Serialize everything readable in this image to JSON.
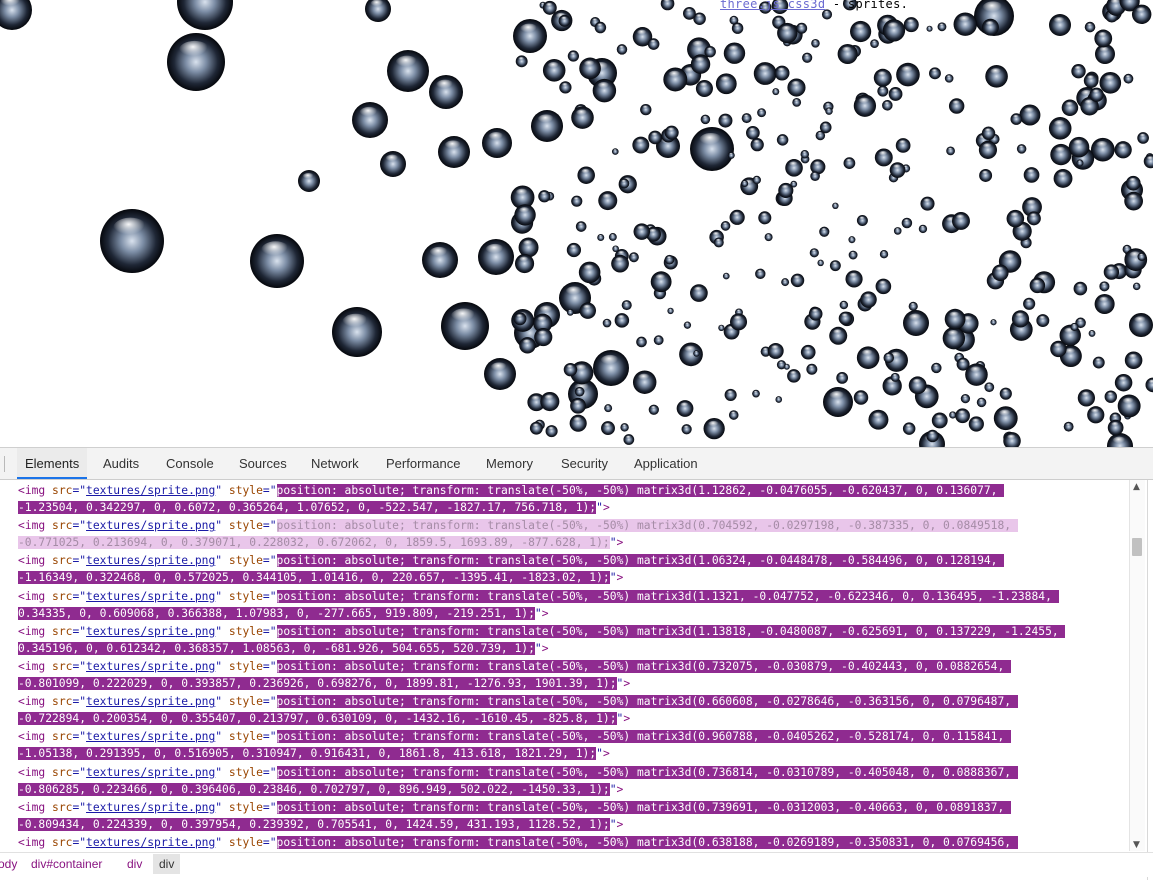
{
  "viewport": {
    "info": {
      "link_text": "three.js css3d",
      "suffix": " - sprites."
    }
  },
  "devtools": {
    "tabs": [
      {
        "label": "Elements",
        "active": true
      },
      {
        "label": "Audits"
      },
      {
        "label": "Console"
      },
      {
        "label": "Sources"
      },
      {
        "label": "Network"
      },
      {
        "label": "Performance"
      },
      {
        "label": "Memory"
      },
      {
        "label": "Security"
      },
      {
        "label": "Application"
      }
    ],
    "elements": [
      {
        "prefix": "<",
        "tag": "img",
        "src_attr": "src",
        "src": "textures/sprite.png",
        "style_attr": "style",
        "style": "position: absolute; transform: translate(-50%, -50%) matrix3d(1.12862, -0.0476055, -0.620437, 0, 0.136077, -1.23504, 0.342297, 0, 0.6072, 0.365264, 1.07652, 0, -522.547, -1827.17, 756.718, 1);",
        "line1": "position: absolute; transform: translate(-50%, -50%) matrix3d(1.12862, -0.0476055, -0.620437, 0, 0.136077, ",
        "line2": "-1.23504, 0.342297, 0, 0.6072, 0.365264, 1.07652, 0, -522.547, -1827.17, 756.718, 1);",
        "dim": false
      },
      {
        "prefix": "<",
        "tag": "img",
        "src_attr": "src",
        "src": "textures/sprite.png",
        "style_attr": "style",
        "line1": "position: absolute; transform: translate(-50%, -50%) matrix3d(0.704592, -0.0297198, -0.387335, 0, 0.0849518, ",
        "line2": "-0.771025, 0.213694, 0, 0.379071, 0.228032, 0.672062, 0, 1859.5, 1693.89, -877.628, 1);",
        "dim": true
      },
      {
        "prefix": "<",
        "tag": "img",
        "src_attr": "src",
        "src": "textures/sprite.png",
        "style_attr": "style",
        "line1": "position: absolute; transform: translate(-50%, -50%) matrix3d(1.06324, -0.0448478, -0.584496, 0, 0.128194, ",
        "line2": "-1.16349, 0.322468, 0, 0.572025, 0.344105, 1.01416, 0, 220.657, -1395.41, -1823.02, 1);",
        "dim": false
      },
      {
        "prefix": "<",
        "tag": "img",
        "src_attr": "src",
        "src": "textures/sprite.png",
        "style_attr": "style",
        "line1": "position: absolute; transform: translate(-50%, -50%) matrix3d(1.1321, -0.047752, -0.622346, 0, 0.136495, -1.23884, ",
        "line2": "0.34335, 0, 0.609068, 0.366388, 1.07983, 0, -277.665, 919.809, -219.251, 1);",
        "dim": false
      },
      {
        "prefix": "<",
        "tag": "img",
        "src_attr": "src",
        "src": "textures/sprite.png",
        "style_attr": "style",
        "line1": "position: absolute; transform: translate(-50%, -50%) matrix3d(1.13818, -0.0480087, -0.625691, 0, 0.137229, -1.2455, ",
        "line2": "0.345196, 0, 0.612342, 0.368357, 1.08563, 0, -681.926, 504.655, 520.739, 1);",
        "dim": false
      },
      {
        "prefix": "<",
        "tag": "img",
        "src_attr": "src",
        "src": "textures/sprite.png",
        "style_attr": "style",
        "line1": "position: absolute; transform: translate(-50%, -50%) matrix3d(0.732075, -0.030879, -0.402443, 0, 0.0882654, ",
        "line2": "-0.801099, 0.222029, 0, 0.393857, 0.236926, 0.698276, 0, 1899.81, -1276.93, 1901.39, 1);",
        "dim": false
      },
      {
        "prefix": "<",
        "tag": "img",
        "src_attr": "src",
        "src": "textures/sprite.png",
        "style_attr": "style",
        "line1": "position: absolute; transform: translate(-50%, -50%) matrix3d(0.660608, -0.0278646, -0.363156, 0, 0.0796487, ",
        "line2": "-0.722894, 0.200354, 0, 0.355407, 0.213797, 0.630109, 0, -1432.16, -1610.45, -825.8, 1);",
        "dim": false
      },
      {
        "prefix": "<",
        "tag": "img",
        "src_attr": "src",
        "src": "textures/sprite.png",
        "style_attr": "style",
        "line1": "position: absolute; transform: translate(-50%, -50%) matrix3d(0.960788, -0.0405262, -0.528174, 0, 0.115841, ",
        "line2": "-1.05138, 0.291395, 0, 0.516905, 0.310947, 0.916431, 0, 1861.8, 413.618, 1821.29, 1);",
        "dim": false
      },
      {
        "prefix": "<",
        "tag": "img",
        "src_attr": "src",
        "src": "textures/sprite.png",
        "style_attr": "style",
        "line1": "position: absolute; transform: translate(-50%, -50%) matrix3d(0.736814, -0.0310789, -0.405048, 0, 0.0888367, ",
        "line2": "-0.806285, 0.223466, 0, 0.396406, 0.23846, 0.702797, 0, 896.949, 502.022, -1450.33, 1);",
        "dim": false
      },
      {
        "prefix": "<",
        "tag": "img",
        "src_attr": "src",
        "src": "textures/sprite.png",
        "style_attr": "style",
        "line1": "position: absolute; transform: translate(-50%, -50%) matrix3d(0.739691, -0.0312003, -0.40663, 0, 0.0891837, ",
        "line2": "-0.809434, 0.224339, 0, 0.397954, 0.239392, 0.705541, 0, 1424.59, 431.193, 1128.52, 1);",
        "dim": false
      },
      {
        "prefix": "<",
        "tag": "img",
        "src_attr": "src",
        "src": "textures/sprite.png",
        "style_attr": "style",
        "line1": "position: absolute; transform: translate(-50%, -50%) matrix3d(0.638188, -0.0269189, -0.350831, 0, 0.0769456, ",
        "line2": null,
        "dim": false
      }
    ],
    "breadcrumbs": [
      {
        "label": "ody"
      },
      {
        "label": "div#container"
      },
      {
        "label": "div"
      },
      {
        "label": "div",
        "selected": true
      }
    ]
  },
  "colors": {
    "highlight": "#8f2b90",
    "tag": "#881280",
    "attr": "#994500",
    "value": "#1a1aa6"
  }
}
